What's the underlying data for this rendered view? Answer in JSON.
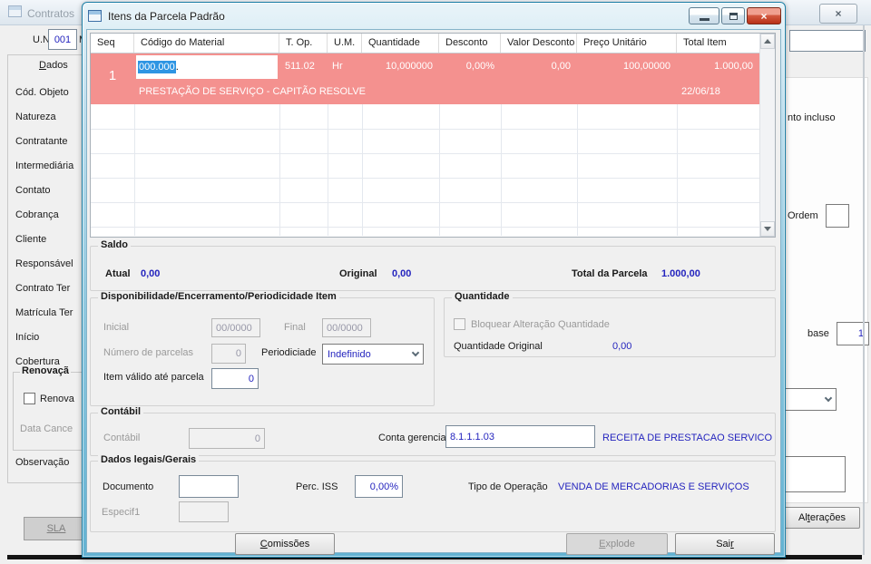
{
  "colors": {
    "value_blue": "#2424BE",
    "row_highlight": "#F4918F",
    "selection_blue": "#2E95E3"
  },
  "background_window": {
    "title": "Contratos",
    "close_glyph": "×",
    "un_label": "U.N.",
    "un_value": "001",
    "un_suffix": "M",
    "sidebar": {
      "dados_tab": {
        "key": "D",
        "post": "ados"
      },
      "items": [
        "Cód. Objeto",
        "Natureza",
        "Contratante",
        "Intermediária",
        "Contato",
        "Cobrança",
        "Cliente",
        "Responsável",
        "Contrato Ter",
        "Matrícula Ter",
        "Início",
        "Cobertura"
      ],
      "renovacao_title": "Renovaçã",
      "renovacao_checkbox": "Renova",
      "data_cancel_label": "Data Cance",
      "observacao_label": "Observação",
      "sla_button": "SLA"
    },
    "right_panel": {
      "incluso_text": "nto incluso",
      "ordem_label": "Ordem",
      "base_label": "base",
      "base_value": "1",
      "alteracoes_button": {
        "pre": "Al",
        "key": "t",
        "post": "erações"
      }
    }
  },
  "dialog": {
    "title": "Itens da Parcela Padrão",
    "close_glyph": "×",
    "grid": {
      "columns": [
        "Seq",
        "Código do Material",
        "T. Op.",
        "U.M.",
        "Quantidade",
        "Desconto",
        "Valor Desconto",
        "Preço Unitário",
        "Total Item"
      ],
      "row": {
        "seq": "1",
        "codigo_selected": "000.000",
        "codigo_suffix": ".",
        "t_op": "511.02",
        "um": "Hr",
        "quantidade": "10,000000",
        "desconto": "0,00%",
        "valor_desconto": "0,00",
        "preco_unitario": "100,00000",
        "total_item": "1.000,00",
        "descricao": "PRESTAÇÃO DE SERVIÇO - CAPITÃO RESOLVE",
        "data": "22/06/18"
      }
    },
    "saldo": {
      "title": "Saldo",
      "atual_label": "Atual",
      "atual_value": "0,00",
      "original_label": "Original",
      "original_value": "0,00",
      "total_label": "Total da Parcela",
      "total_value": "1.000,00"
    },
    "disponibilidade": {
      "title": "Disponibilidade/Encerramento/Periodicidade Item",
      "inicial_label": "Inicial",
      "inicial_value": "00/0000",
      "final_label": "Final",
      "final_value": "00/0000",
      "num_parcelas_label": "Número de parcelas",
      "num_parcelas_value": "0",
      "periodicidade_label": "Periodiciade",
      "periodicidade_value": "Indefinido",
      "item_valido_label": "Item válido até parcela",
      "item_valido_value": "0"
    },
    "quantidade": {
      "title": "Quantidade",
      "bloquear_label": "Bloquear Alteração Quantidade",
      "original_label": "Quantidade Original",
      "original_value": "0,00"
    },
    "contabil": {
      "title": "Contábil",
      "contabil_label": "Contábil",
      "contabil_value": "0",
      "conta_gerencial_label": "Conta gerencial",
      "conta_gerencial_value": "8.1.1.1.03",
      "conta_gerencial_desc": "RECEITA DE PRESTACAO SERVICO"
    },
    "dados_legais": {
      "title": "Dados legais/Gerais",
      "documento_label": "Documento",
      "perc_iss_label": "Perc. ISS",
      "perc_iss_value": "0,00%",
      "tipo_operacao_label": "Tipo de Operação",
      "tipo_operacao_value": "VENDA DE MERCADORIAS E SERVIÇOS",
      "especif1_label": "Especif1"
    },
    "buttons": {
      "comissoes": {
        "pre": "",
        "key": "C",
        "post": "omissões"
      },
      "explode": {
        "pre": "",
        "key": "E",
        "post": "xplode"
      },
      "sair": {
        "pre": "Sai",
        "key": "r",
        "post": ""
      }
    }
  }
}
